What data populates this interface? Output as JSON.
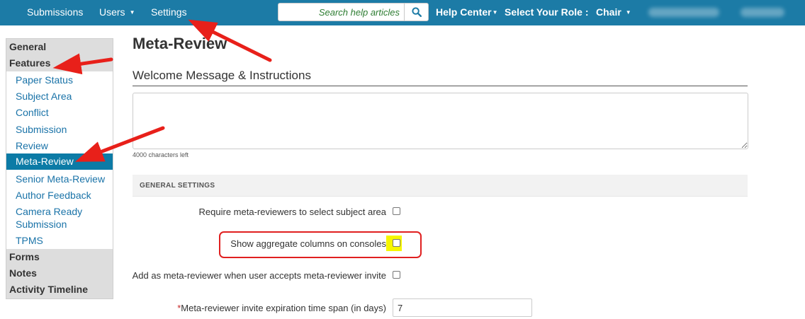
{
  "navbar": {
    "submissions": "Submissions",
    "users": "Users",
    "settings": "Settings",
    "search_placeholder": "Search help articles",
    "help_center": "Help Center",
    "select_role_label": "Select Your Role :",
    "role_value": "Chair",
    "colors": {
      "background": "#1c7ba6",
      "text": "#ffffff",
      "search_text": "#2e7d32"
    },
    "icons": [
      "caret-down-icon",
      "search-icon"
    ]
  },
  "sidebar": {
    "sections": {
      "general": "General",
      "features": "Features",
      "forms": "Forms",
      "notes": "Notes",
      "activity_timeline": "Activity Timeline"
    },
    "items": [
      {
        "label": "Paper Status"
      },
      {
        "label": "Subject Area"
      },
      {
        "label": "Conflict"
      },
      {
        "label": "Submission"
      },
      {
        "label": "Review"
      },
      {
        "label": "Meta-Review",
        "active": true
      },
      {
        "label": "Senior Meta-Review"
      },
      {
        "label": "Author Feedback"
      },
      {
        "label": "Camera Ready"
      },
      {
        "label": "Submission"
      },
      {
        "label": "TPMS"
      }
    ],
    "colors": {
      "section_bg": "#dddddd",
      "link": "#1a73a8",
      "active_bg": "#0c7ba6"
    }
  },
  "main": {
    "title": "Meta-Review",
    "welcome_heading": "Welcome Message & Instructions",
    "welcome_value": "",
    "chars_left": "4000 characters left",
    "panel_title": "GENERAL SETTINGS",
    "settings": [
      {
        "label": "Require meta-reviewers to select subject area",
        "checked": false
      },
      {
        "label": "Show aggregate columns on consoles",
        "checked": false
      },
      {
        "label": "Add as meta-reviewer when user accepts meta-reviewer invite",
        "checked": false
      }
    ],
    "expiration": {
      "required_mark": "*",
      "label": "Meta-reviewer invite expiration time span (in days)",
      "value": "7"
    }
  },
  "annotations": {
    "arrow_color": "#e8201a",
    "highlight_box_color": "#e02020",
    "checkbox_highlight_color": "#f6f600"
  }
}
